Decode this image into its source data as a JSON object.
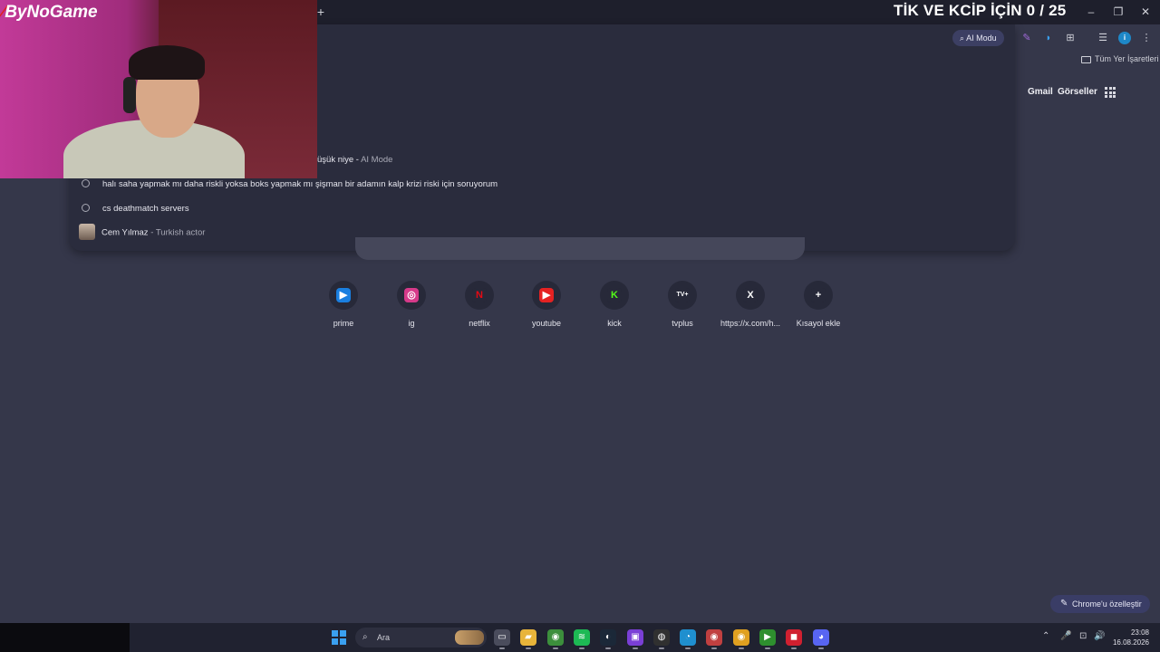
{
  "titlebar": {
    "new_tab": "+",
    "overlay_text": "TİK VE KCİP İÇİN 0 / 25",
    "minimize": "–",
    "restore": "❐",
    "close": "✕"
  },
  "toolbar": {
    "ai_mode_label": "AI Modu",
    "profile_initial": "i",
    "menu": "⋮"
  },
  "bookmarks": {
    "all_bookmarks": "Tüm Yer İşaretleri"
  },
  "header": {
    "gmail": "Gmail",
    "images": "Görseller"
  },
  "webcam": {
    "logo_mark": "⁄",
    "logo_text": "ByNoGame"
  },
  "suggestions": {
    "partial": {
      "text": "üşük niye",
      "sep": " - ",
      "sub": "AI Mode"
    },
    "items": [
      {
        "text": "halı saha yapmak mı daha riskli yoksa boks yapmak mı şişman bir adamın kalp krizi riski için soruyorum"
      },
      {
        "text": "cs deathmatch servers"
      },
      {
        "text": "Cem Yılmaz",
        "sep": " - ",
        "sub": "Turkish actor"
      }
    ]
  },
  "shortcuts": [
    {
      "label": "prime",
      "glyph": "▶",
      "color": "#1a7fe0",
      "icon": "prime-video-icon"
    },
    {
      "label": "ig",
      "glyph": "◎",
      "color": "#d63a8a",
      "icon": "instagram-icon"
    },
    {
      "label": "netflix",
      "glyph": "N",
      "color": "#272939",
      "text_color": "#e50914",
      "icon": "netflix-icon"
    },
    {
      "label": "youtube",
      "glyph": "▶",
      "color": "#e52222",
      "icon": "youtube-icon"
    },
    {
      "label": "kick",
      "glyph": "K",
      "color": "#272939",
      "text_color": "#53fc18",
      "icon": "kick-icon"
    },
    {
      "label": "tvplus",
      "glyph": "TV+",
      "color": "#272939",
      "icon": "tvplus-icon"
    },
    {
      "label": "https://x.com/h...",
      "glyph": "X",
      "color": "#272939",
      "icon": "x-icon"
    },
    {
      "label": "Kısayol ekle",
      "glyph": "+",
      "color": "#272939",
      "icon": "plus-icon"
    }
  ],
  "customize": {
    "label": "Chrome'u özelleştir",
    "pen": "✎"
  },
  "taskbar": {
    "search_label": "Ara",
    "search_glyph": "⌕",
    "time": "23:08",
    "date": "16.08.2026",
    "apps": [
      {
        "name": "task-view-icon",
        "glyph": "▭",
        "color": "#4a4c5c"
      },
      {
        "name": "file-explorer-icon",
        "glyph": "▰",
        "color": "#e8b43a"
      },
      {
        "name": "chrome-icon",
        "glyph": "◉",
        "color": "#3c8f3c"
      },
      {
        "name": "spotify-icon",
        "glyph": "≋",
        "color": "#1db954"
      },
      {
        "name": "steam-icon",
        "glyph": "◐",
        "color": "#1b2838"
      },
      {
        "name": "clipchamp-icon",
        "glyph": "▣",
        "color": "#7a3fd6"
      },
      {
        "name": "obs-icon",
        "glyph": "◍",
        "color": "#303030"
      },
      {
        "name": "edge-icon",
        "glyph": "◔",
        "color": "#1f8fcf"
      },
      {
        "name": "chrome-profile-icon",
        "glyph": "◉",
        "color": "#c04040"
      },
      {
        "name": "chrome-canary-icon",
        "glyph": "◉",
        "color": "#e0a020"
      },
      {
        "name": "kick-app-icon",
        "glyph": "▶",
        "color": "#2e8f2e"
      },
      {
        "name": "bynogame-app-icon",
        "glyph": "◼",
        "color": "#d02030"
      },
      {
        "name": "discord-icon",
        "glyph": "◕",
        "color": "#5865f2"
      }
    ],
    "tray": {
      "chevron": "⌃",
      "mic": "🎤",
      "network": "⊡",
      "volume": "🔊"
    }
  }
}
